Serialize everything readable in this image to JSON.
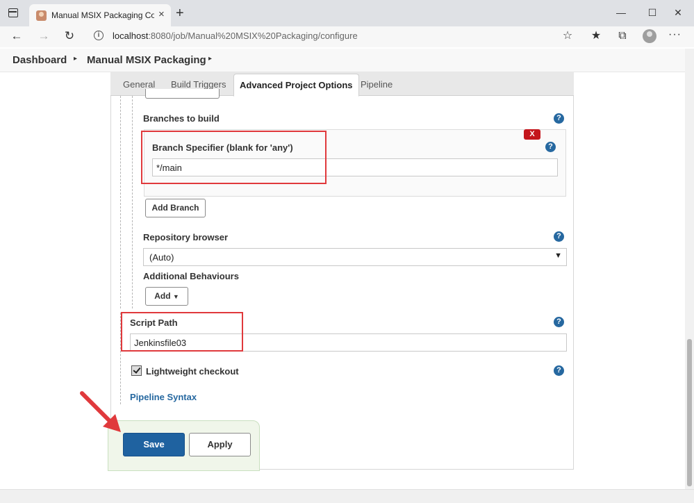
{
  "browser": {
    "tab_title": "Manual MSIX Packaging Config",
    "tab_close": "×",
    "new_tab": "+",
    "url_host": "localhost",
    "url_path": ":8080/job/Manual%20MSIX%20Packaging/configure",
    "controls": {
      "minimize": "—",
      "maximize": "☐",
      "close": "✕"
    },
    "nav": {
      "back": "←",
      "forward": "→",
      "refresh": "↻"
    },
    "toolbar_icons": [
      "favorite-add-icon",
      "favorites-icon",
      "collections-icon",
      "profile-icon",
      "more-icon"
    ]
  },
  "breadcrumb": {
    "items": [
      "Dashboard",
      "Manual MSIX Packaging"
    ],
    "separator": "▸"
  },
  "tabs": {
    "items": [
      "General",
      "Build Triggers",
      "Advanced Project Options",
      "Pipeline"
    ],
    "active": "Advanced Project Options"
  },
  "form": {
    "branches_label": "Branches to build",
    "branch_specifier_label": "Branch Specifier (blank for 'any')",
    "branch_specifier_value": "*/main",
    "delete_label": "X",
    "add_branch_label": "Add Branch",
    "repo_browser_label": "Repository browser",
    "repo_browser_value": "(Auto)",
    "additional_behaviours_label": "Additional Behaviours",
    "add_label": "Add",
    "script_path_label": "Script Path",
    "script_path_value": "Jenkinsfile03",
    "lightweight_label": "Lightweight checkout",
    "lightweight_checked": true,
    "pipeline_syntax_link": "Pipeline Syntax",
    "help_glyph": "?"
  },
  "actions": {
    "save_label": "Save",
    "apply_label": "Apply"
  },
  "colors": {
    "accent": "#1f62a0",
    "highlight": "#e0393c",
    "delete": "#c4161c",
    "save_bar": "#f0f6ea"
  }
}
